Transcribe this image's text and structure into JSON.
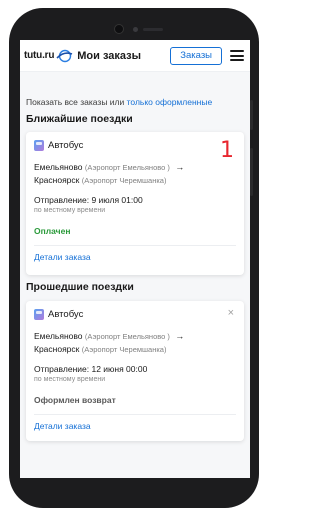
{
  "header": {
    "logo_text": "tutu.ru",
    "title": "Мои заказы",
    "orders_button": "Заказы"
  },
  "filter": {
    "prefix": "Показать все заказы или",
    "link": "только оформленные"
  },
  "upcoming": {
    "section_title": "Ближайшие поездки",
    "annotation": "1",
    "card": {
      "transport": "Автобус",
      "from_city": "Емельяново",
      "from_port": "(Аэропорт Емельяново )",
      "arrow": "→",
      "to_city": "Красноярск",
      "to_port": "(Аэропорт Черемшанка)",
      "departure": "Отправление: 9 июля 01:00",
      "local_time": "по местному времени",
      "status": "Оплачен",
      "details_link": "Детали заказа"
    }
  },
  "past": {
    "section_title": "Прошедшие поездки",
    "card": {
      "transport": "Автобус",
      "close": "×",
      "from_city": "Емельяново",
      "from_port": "(Аэропорт Емельяново )",
      "arrow": "→",
      "to_city": "Красноярск",
      "to_port": "(Аэропорт Черемшанка)",
      "departure": "Отправление: 12 июня 00:00",
      "local_time": "по местному времени",
      "status": "Оформлен возврат",
      "details_link": "Детали заказа"
    }
  },
  "colors": {
    "accent": "#1570d6",
    "paid": "#2a9a3a",
    "annotation": "#e8262e",
    "phone_frame": "#1c1c1e"
  }
}
